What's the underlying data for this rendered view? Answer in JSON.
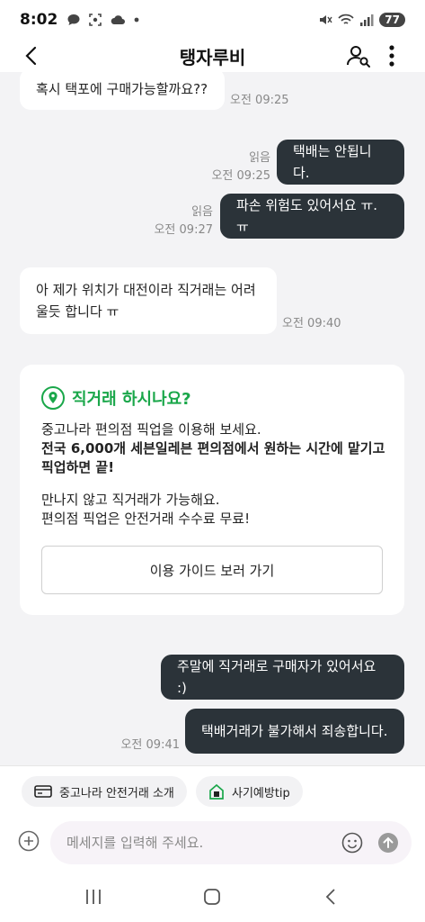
{
  "status": {
    "time": "8:02",
    "battery": "77"
  },
  "header": {
    "title": "탱자루비"
  },
  "messages": [
    {
      "dir": "in",
      "text": "혹시 택포에 구매가능할까요??",
      "time": "오전 09:25"
    },
    {
      "dir": "out",
      "text": "택배는 안됩니다.",
      "read": "읽음",
      "time": "오전 09:25"
    },
    {
      "dir": "out",
      "text": "파손 위험도 있어서요 ㅠ.ㅠ",
      "read": "읽음",
      "time": "오전 09:27"
    },
    {
      "dir": "in",
      "text_line1": "아 제가 위치가 대전이라 직거래는 어려",
      "text_line2": "울듯 합니다 ㅠ",
      "time": "오전 09:40"
    },
    {
      "dir": "out",
      "text": "주말에 직거래로 구매자가 있어서요 :)"
    },
    {
      "dir": "out",
      "text": "택배거래가 불가해서 죄송합니다.",
      "time": "오전 09:41"
    }
  ],
  "card": {
    "title": "직거래 하시나요?",
    "line1": "중고나라 편의점 픽업을 이용해 보세요.",
    "line2_bold": "전국 6,000개 세븐일레븐 편의점",
    "line2_rest": "에서 원하는 시간에 맡기고",
    "line3_bold": "픽업",
    "line3_rest": "하면 끝!",
    "line4": "만나지 않고 직거래가 가능해요.",
    "line5": "편의점 픽업은 안전거래 수수료 무료!",
    "button": "이용 가이드 보러 가기"
  },
  "chips": [
    {
      "label": "중고나라 안전거래 소개",
      "icon": "card-icon"
    },
    {
      "label": "사기예방tip",
      "icon": "lock-house-icon"
    }
  ],
  "input": {
    "placeholder": "메세지를 입력해 주세요."
  },
  "colors": {
    "accent_green": "#1aa74a",
    "bubble_dark": "#2b3339",
    "background": "#f3f3f5"
  }
}
